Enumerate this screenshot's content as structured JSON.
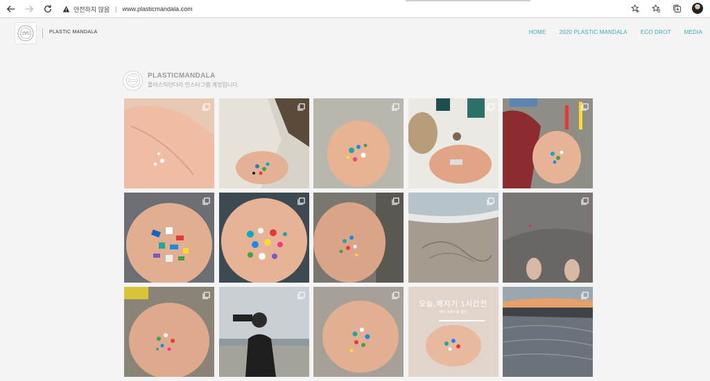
{
  "browser": {
    "security_label": "안전하지 않음",
    "url": "www.plasticmandala.com"
  },
  "site": {
    "title": "PLASTIC MANDALA",
    "nav": [
      "HOME",
      "2020 PLASTIC MANDALA",
      "ECO DROT",
      "MEDIA"
    ]
  },
  "feed": {
    "username": "PLASTICMANDALA",
    "bio": "플라스틱만다라 인스타그램 계정입니다."
  },
  "grid": {
    "tile_14_title": "오늘,해지기 1시간전",
    "tile_14_subtitle": "바다 쓰레기를 줍다"
  },
  "icons": {
    "back": "arrow-left-icon",
    "forward": "arrow-right-icon",
    "reload": "reload-icon",
    "warning": "warning-icon",
    "carousel": "multiple-images-icon"
  },
  "colors": {
    "accent": "#3aaab0",
    "page_bg": "#f4f4f4"
  }
}
